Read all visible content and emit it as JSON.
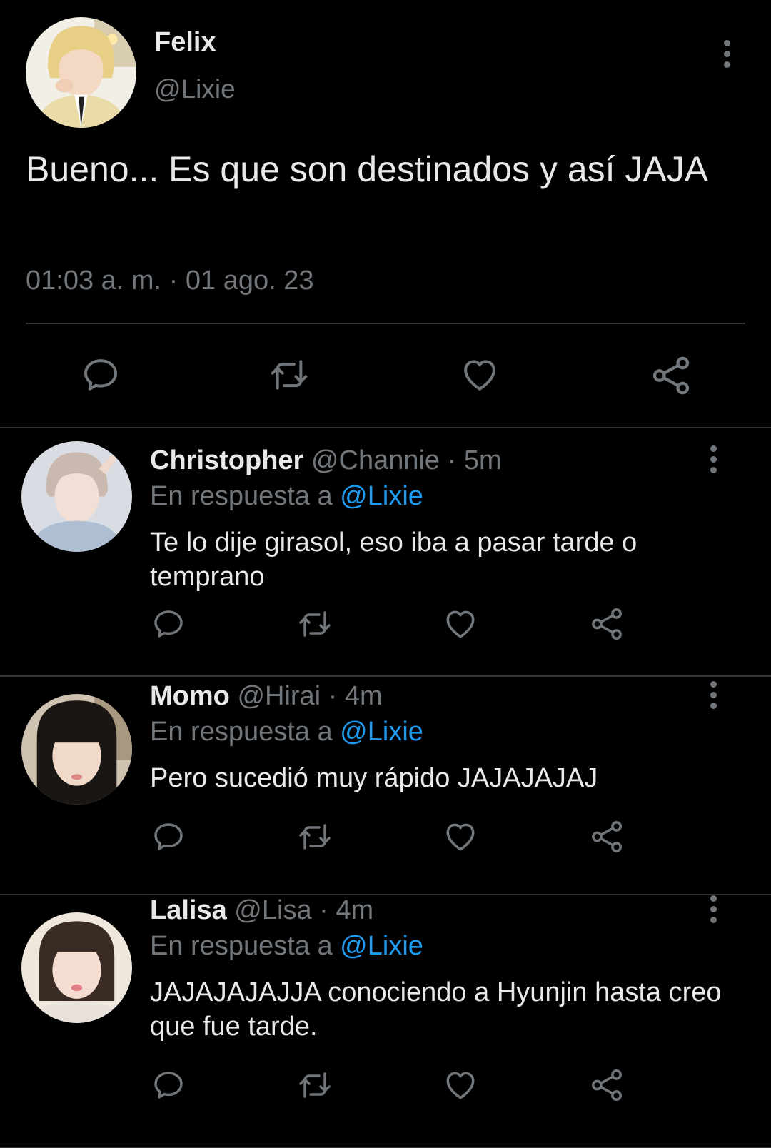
{
  "main_tweet": {
    "name": "Felix",
    "handle": "@Lixie",
    "text": "Bueno... Es que son destinados y así JAJA",
    "timestamp": "01:03 a. m. · 01 ago. 23",
    "actions": [
      "reply-icon",
      "retweet-icon",
      "like-icon",
      "share-icon"
    ]
  },
  "replies": [
    {
      "name": "Christopher",
      "handle": "@Channie",
      "time": "· 5m",
      "in_reply_prefix": "En respuesta a ",
      "in_reply_mention": "@Lixie",
      "text": "Te lo dije girasol, eso iba a pasar tarde o temprano"
    },
    {
      "name": "Momo",
      "handle": "@Hirai",
      "time": "· 4m",
      "in_reply_prefix": "En respuesta a ",
      "in_reply_mention": "@Lixie",
      "text": "Pero sucedió muy rápido JAJAJAJAJ"
    },
    {
      "name": "Lalisa",
      "handle": "@Lisa",
      "time": "· 4m",
      "in_reply_prefix": "En respuesta a ",
      "in_reply_mention": "@Lixie",
      "text": "JAJAJAJAJJA conociendo a Hyunjin hasta creo que fue tarde."
    }
  ],
  "colors": {
    "background": "#000000",
    "text": "#e7e9ea",
    "muted": "#71767b",
    "mention": "#1d9bf0",
    "divider": "#2f3336"
  }
}
